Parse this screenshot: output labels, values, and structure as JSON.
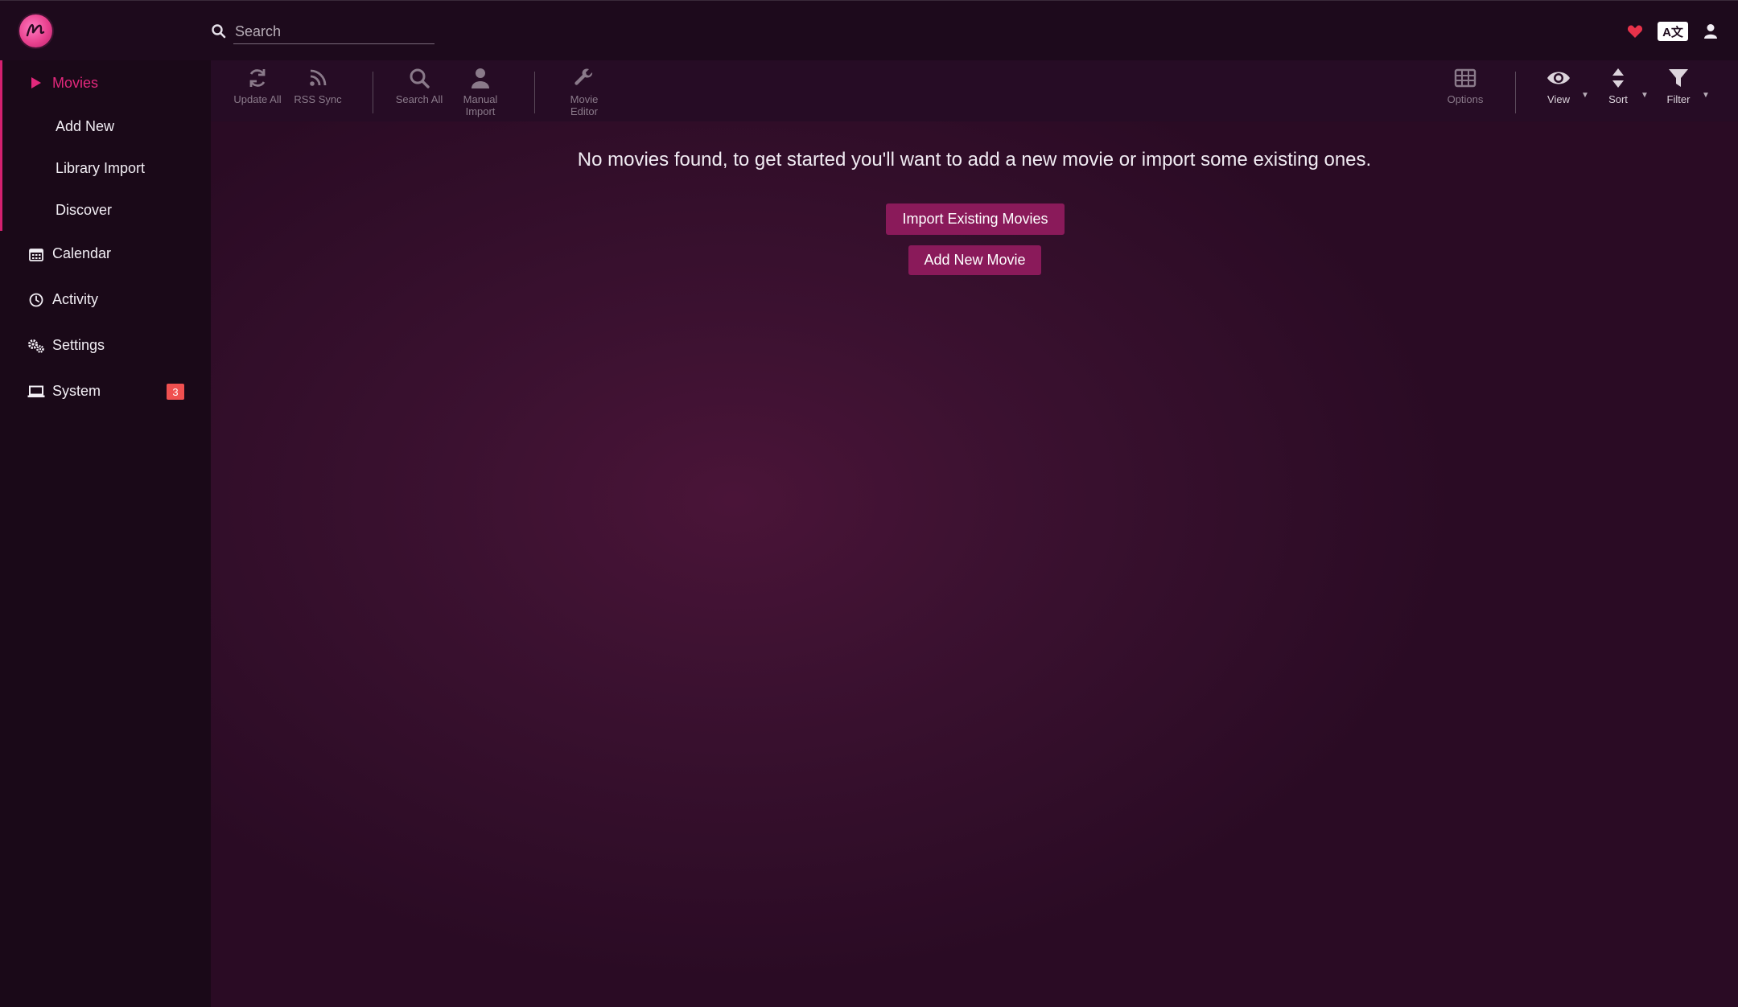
{
  "header": {
    "search_placeholder": "Search",
    "lang_label": "A文"
  },
  "sidebar": {
    "movies": {
      "label": "Movies",
      "subitems": [
        "Add New",
        "Library Import",
        "Discover"
      ]
    },
    "items": [
      {
        "label": "Calendar",
        "icon": "calendar-icon"
      },
      {
        "label": "Activity",
        "icon": "clock-icon"
      },
      {
        "label": "Settings",
        "icon": "gears-icon"
      },
      {
        "label": "System",
        "icon": "laptop-icon",
        "badge": "3"
      }
    ]
  },
  "toolbar": {
    "update_all": "Update All",
    "rss_sync": "RSS Sync",
    "search_all": "Search All",
    "manual_import_1": "Manual",
    "manual_import_2": "Import",
    "movie_editor_1": "Movie",
    "movie_editor_2": "Editor",
    "options": "Options",
    "view": "View",
    "sort": "Sort",
    "filter": "Filter"
  },
  "content": {
    "empty_message": "No movies found, to get started you'll want to add a new movie or import some existing ones.",
    "import_button": "Import Existing Movies",
    "add_button": "Add New Movie"
  },
  "colors": {
    "accent": "#e2287c",
    "button": "#8a1a5a",
    "badge": "#f05050"
  }
}
